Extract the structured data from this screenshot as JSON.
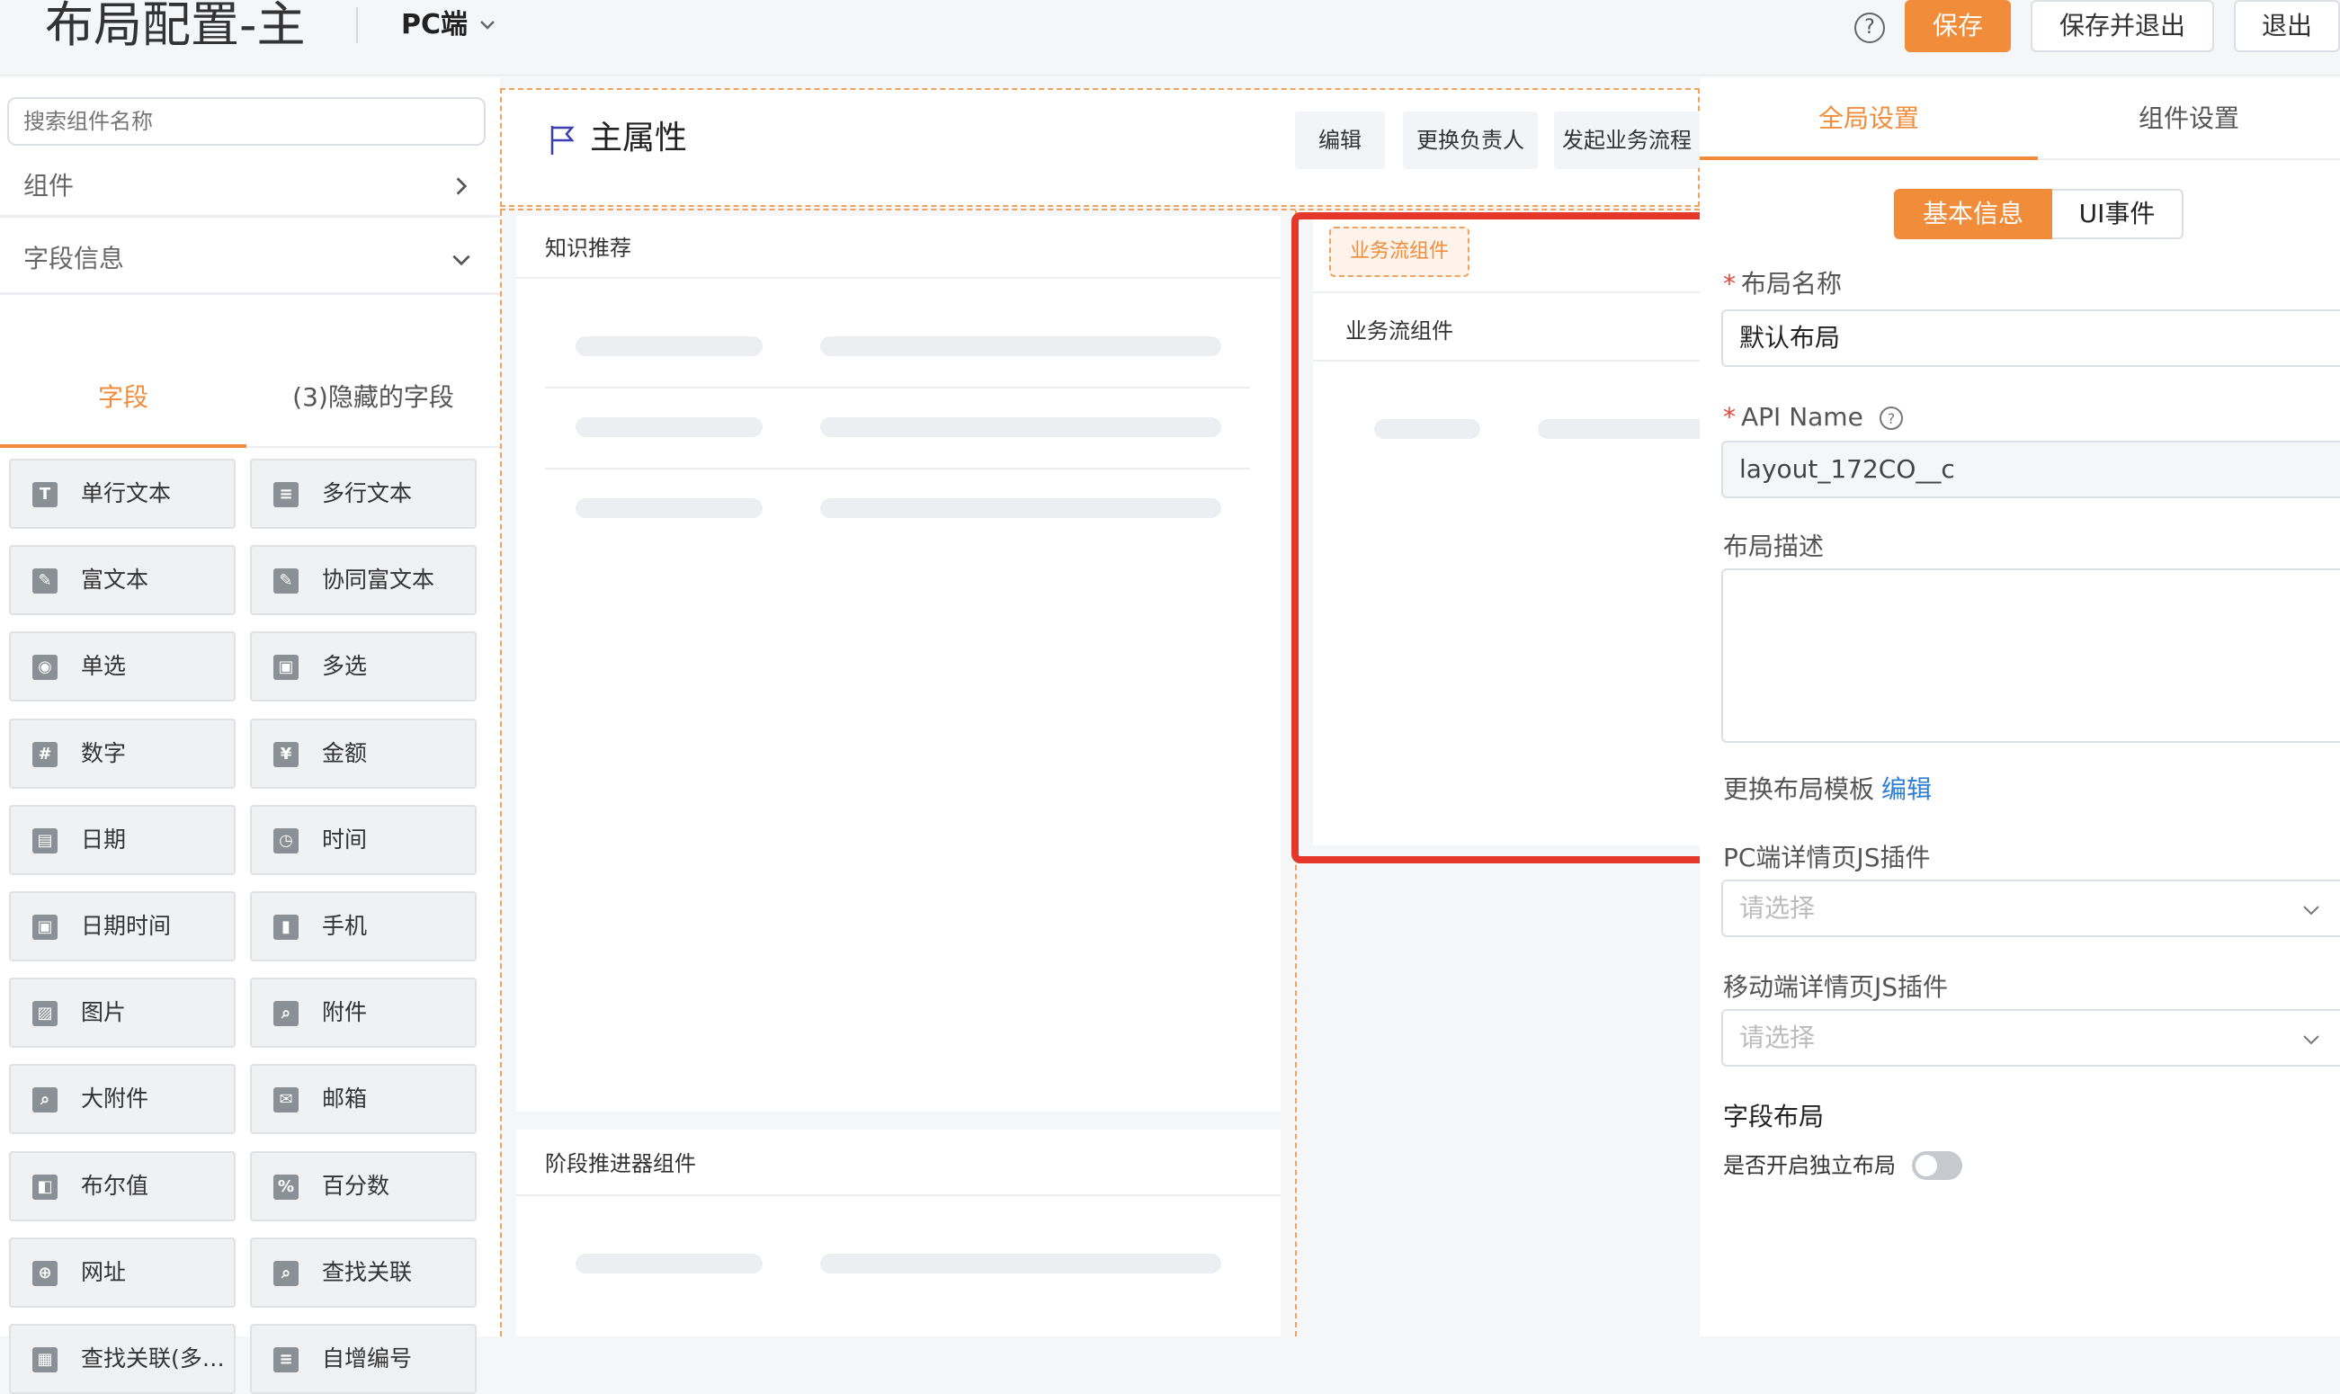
{
  "header": {
    "title": "布局配置-主",
    "device": "PC端",
    "help_icon": "?",
    "save_label": "保存",
    "save_exit_label": "保存并退出",
    "exit_label": "退出"
  },
  "sidebar": {
    "search_placeholder": "搜索组件名称",
    "components_label": "组件",
    "field_info_label": "字段信息",
    "tab_fields": "字段",
    "tab_hidden": "(3)隐藏的字段",
    "fields": [
      {
        "label": "单行文本",
        "icon": "T"
      },
      {
        "label": "多行文本",
        "icon": "≡"
      },
      {
        "label": "富文本",
        "icon": "✎"
      },
      {
        "label": "协同富文本",
        "icon": "✎"
      },
      {
        "label": "单选",
        "icon": "◉"
      },
      {
        "label": "多选",
        "icon": "▣"
      },
      {
        "label": "数字",
        "icon": "#"
      },
      {
        "label": "金额",
        "icon": "¥"
      },
      {
        "label": "日期",
        "icon": "▤"
      },
      {
        "label": "时间",
        "icon": "◷"
      },
      {
        "label": "日期时间",
        "icon": "▣"
      },
      {
        "label": "手机",
        "icon": "▮"
      },
      {
        "label": "图片",
        "icon": "▨"
      },
      {
        "label": "附件",
        "icon": "⌕"
      },
      {
        "label": "大附件",
        "icon": "⌕"
      },
      {
        "label": "邮箱",
        "icon": "✉"
      },
      {
        "label": "布尔值",
        "icon": "◧"
      },
      {
        "label": "百分数",
        "icon": "%"
      },
      {
        "label": "网址",
        "icon": "⊕"
      },
      {
        "label": "查找关联",
        "icon": "⌕"
      },
      {
        "label": "查找关联(多…",
        "icon": "▦"
      },
      {
        "label": "自增编号",
        "icon": "≡"
      }
    ]
  },
  "canvas": {
    "main_title": "主属性",
    "btn_edit": "编辑",
    "btn_owner": "更换负责人",
    "btn_flow": "发起业务流程",
    "panel_knowledge": "知识推荐",
    "panel_stage": "阶段推进器组件",
    "panel_flow_tag": "业务流组件",
    "panel_flow_title": "业务流组件"
  },
  "settings": {
    "tab_global": "全局设置",
    "tab_component": "组件设置",
    "seg_basic": "基本信息",
    "seg_ui": "UI事件",
    "layout_name_label": "布局名称",
    "layout_name_value": "默认布局",
    "api_name_label": "API Name",
    "api_name_value": "layout_172CO__c",
    "desc_label": "布局描述",
    "template_label": "更换布局模板",
    "template_edit": "编辑",
    "pc_js_label": "PC端详情页JS插件",
    "pc_js_placeholder": "请选择",
    "mobile_js_label": "移动端详情页JS插件",
    "mobile_js_placeholder": "请选择",
    "field_layout_label": "字段布局",
    "independent_label": "是否开启独立布局",
    "independent_on": false
  },
  "colors": {
    "accent": "#f08c3a",
    "highlight": "#e5382b",
    "link": "#2f7fd6"
  }
}
